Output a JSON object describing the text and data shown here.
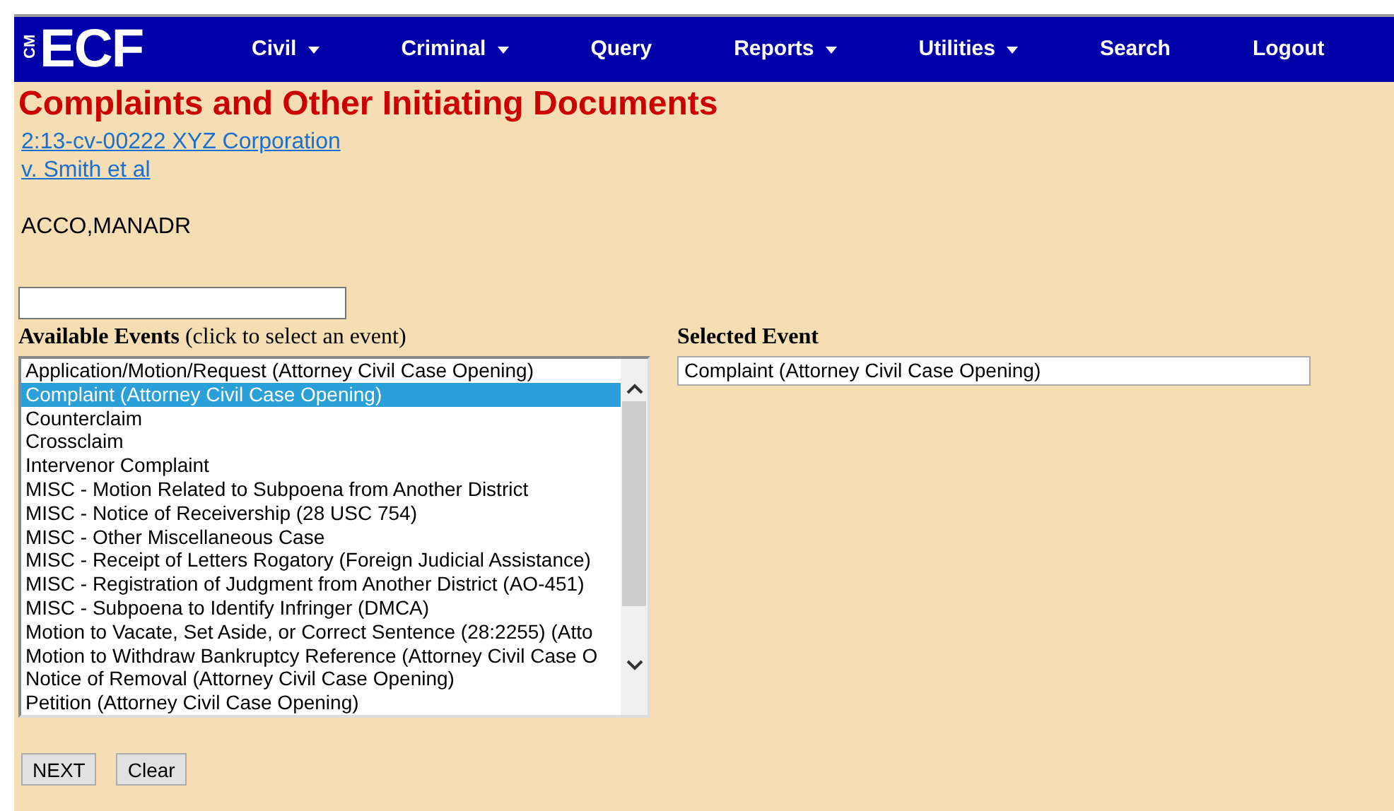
{
  "logo": {
    "small": "CM",
    "large": "ECF"
  },
  "menu": [
    {
      "label": "Civil",
      "dropdown": true
    },
    {
      "label": "Criminal",
      "dropdown": true
    },
    {
      "label": "Query",
      "dropdown": false
    },
    {
      "label": "Reports",
      "dropdown": true
    },
    {
      "label": "Utilities",
      "dropdown": true
    },
    {
      "label": "Search",
      "dropdown": false
    },
    {
      "label": "Logout",
      "dropdown": false
    }
  ],
  "title": "Complaints and Other Initiating Documents",
  "case_links": [
    "2:13-cv-00222 XYZ Corporation",
    "v. Smith et al"
  ],
  "user": "ACCO,MANADR",
  "available_events": {
    "label": "**Available Events** (click to select an event)",
    "items": [
      {
        "label": "Application/Motion/Request (Attorney Civil Case Opening)",
        "selected": false
      },
      {
        "label": "Complaint (Attorney Civil Case Opening)",
        "selected": true
      },
      {
        "label": "Counterclaim",
        "selected": false
      },
      {
        "label": "Crossclaim",
        "selected": false
      },
      {
        "label": "Intervenor Complaint",
        "selected": false
      },
      {
        "label": "MISC - Motion Related to Subpoena from Another District",
        "selected": false
      },
      {
        "label": "MISC - Notice of Receivership (28 USC 754)",
        "selected": false
      },
      {
        "label": "MISC - Other Miscellaneous Case",
        "selected": false
      },
      {
        "label": "MISC - Receipt of Letters Rogatory (Foreign Judicial Assistance)",
        "selected": false
      },
      {
        "label": "MISC - Registration of Judgment from Another District (AO-451)",
        "selected": false
      },
      {
        "label": "MISC - Subpoena to Identify Infringer (DMCA)",
        "selected": false
      },
      {
        "label": "Motion to Vacate, Set Aside, or Correct Sentence (28:2255) (Atto",
        "selected": false
      },
      {
        "label": "Motion to Withdraw Bankruptcy Reference (Attorney Civil Case O",
        "selected": false
      },
      {
        "label": "Notice of Removal (Attorney Civil Case Opening)",
        "selected": false
      },
      {
        "label": "Petition (Attorney Civil Case Opening)",
        "selected": false
      }
    ]
  },
  "selected_event": {
    "label": "Selected Event",
    "value": "Complaint (Attorney Civil Case Opening)"
  },
  "buttons": [
    "NEXT",
    "Clear"
  ]
}
